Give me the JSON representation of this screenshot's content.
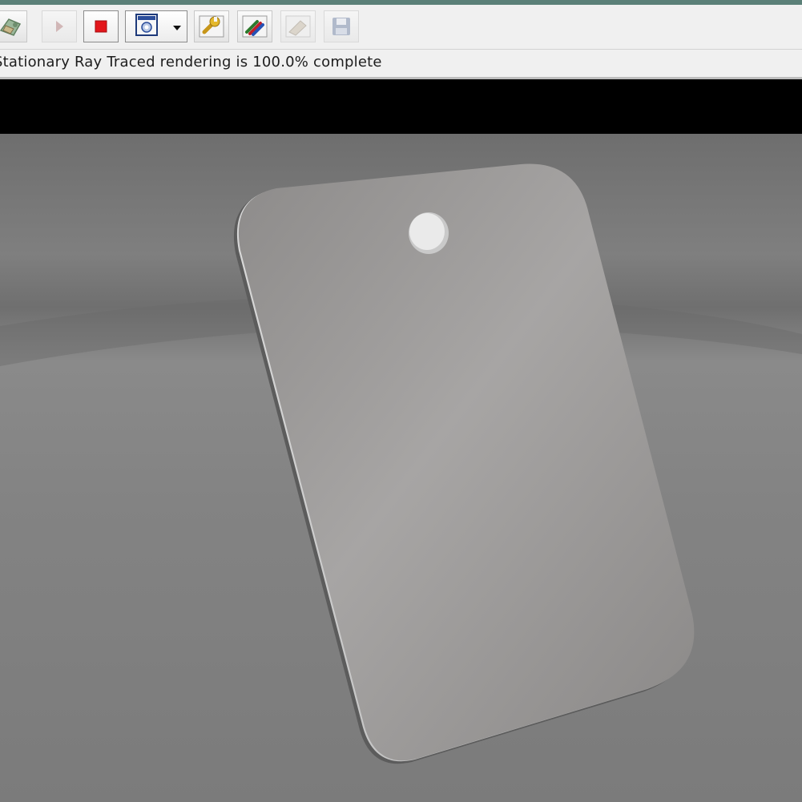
{
  "toolbar": {
    "buttons": [
      {
        "name": "camera-view-icon",
        "state": "partial"
      },
      {
        "name": "play-icon",
        "state": "disabled"
      },
      {
        "name": "stop-icon",
        "state": "active"
      },
      {
        "name": "render-region-icon",
        "state": "active",
        "dropdown": true
      },
      {
        "name": "wrench-settings-icon",
        "state": "normal"
      },
      {
        "name": "color-pencils-icon",
        "state": "normal"
      },
      {
        "name": "eraser-icon",
        "state": "disabled"
      },
      {
        "name": "floppy-disk-save-icon",
        "state": "disabled"
      }
    ],
    "stop_color": "#e3161b"
  },
  "status": {
    "text": "Stationary Ray Traced rendering is 100.0% complete",
    "progress_percent": 100.0
  },
  "viewport": {
    "background_color": "#7a7a7a",
    "object": "rounded-rectangle-tag-with-hole",
    "tag_color": "#a3a1a0"
  },
  "colors": {
    "title_strip": "#5b8078",
    "toolbar_bg": "#f0f0f0",
    "band": "#000000"
  }
}
